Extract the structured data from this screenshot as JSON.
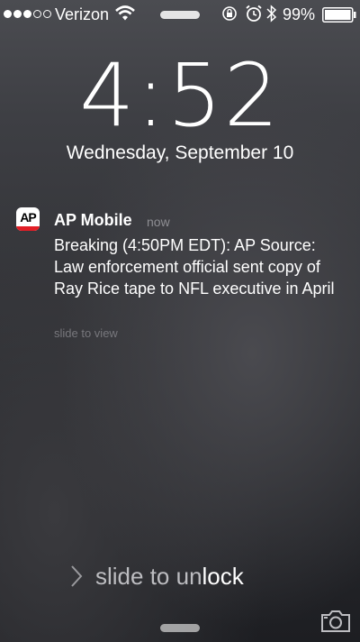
{
  "status_bar": {
    "signal_bars_filled": 3,
    "signal_bars_total": 5,
    "carrier": "Verizon",
    "battery_percent": "99%",
    "icons": [
      "wifi-icon",
      "rotation-lock-icon",
      "alarm-icon",
      "bluetooth-icon",
      "battery-icon"
    ]
  },
  "lock_screen": {
    "time": "4:52",
    "date": "Wednesday, September 10"
  },
  "notification": {
    "app_icon_text": "AP",
    "app_name": "AP Mobile",
    "time_ago": "now",
    "body": "Breaking (4:50PM EDT): AP Source: Law enforcement official sent copy of Ray Rice tape to NFL executive in April",
    "action_hint": "slide to view",
    "brand_red": "#e21e26"
  },
  "unlock": {
    "label_start": "slide to un",
    "label_end": "lock"
  }
}
